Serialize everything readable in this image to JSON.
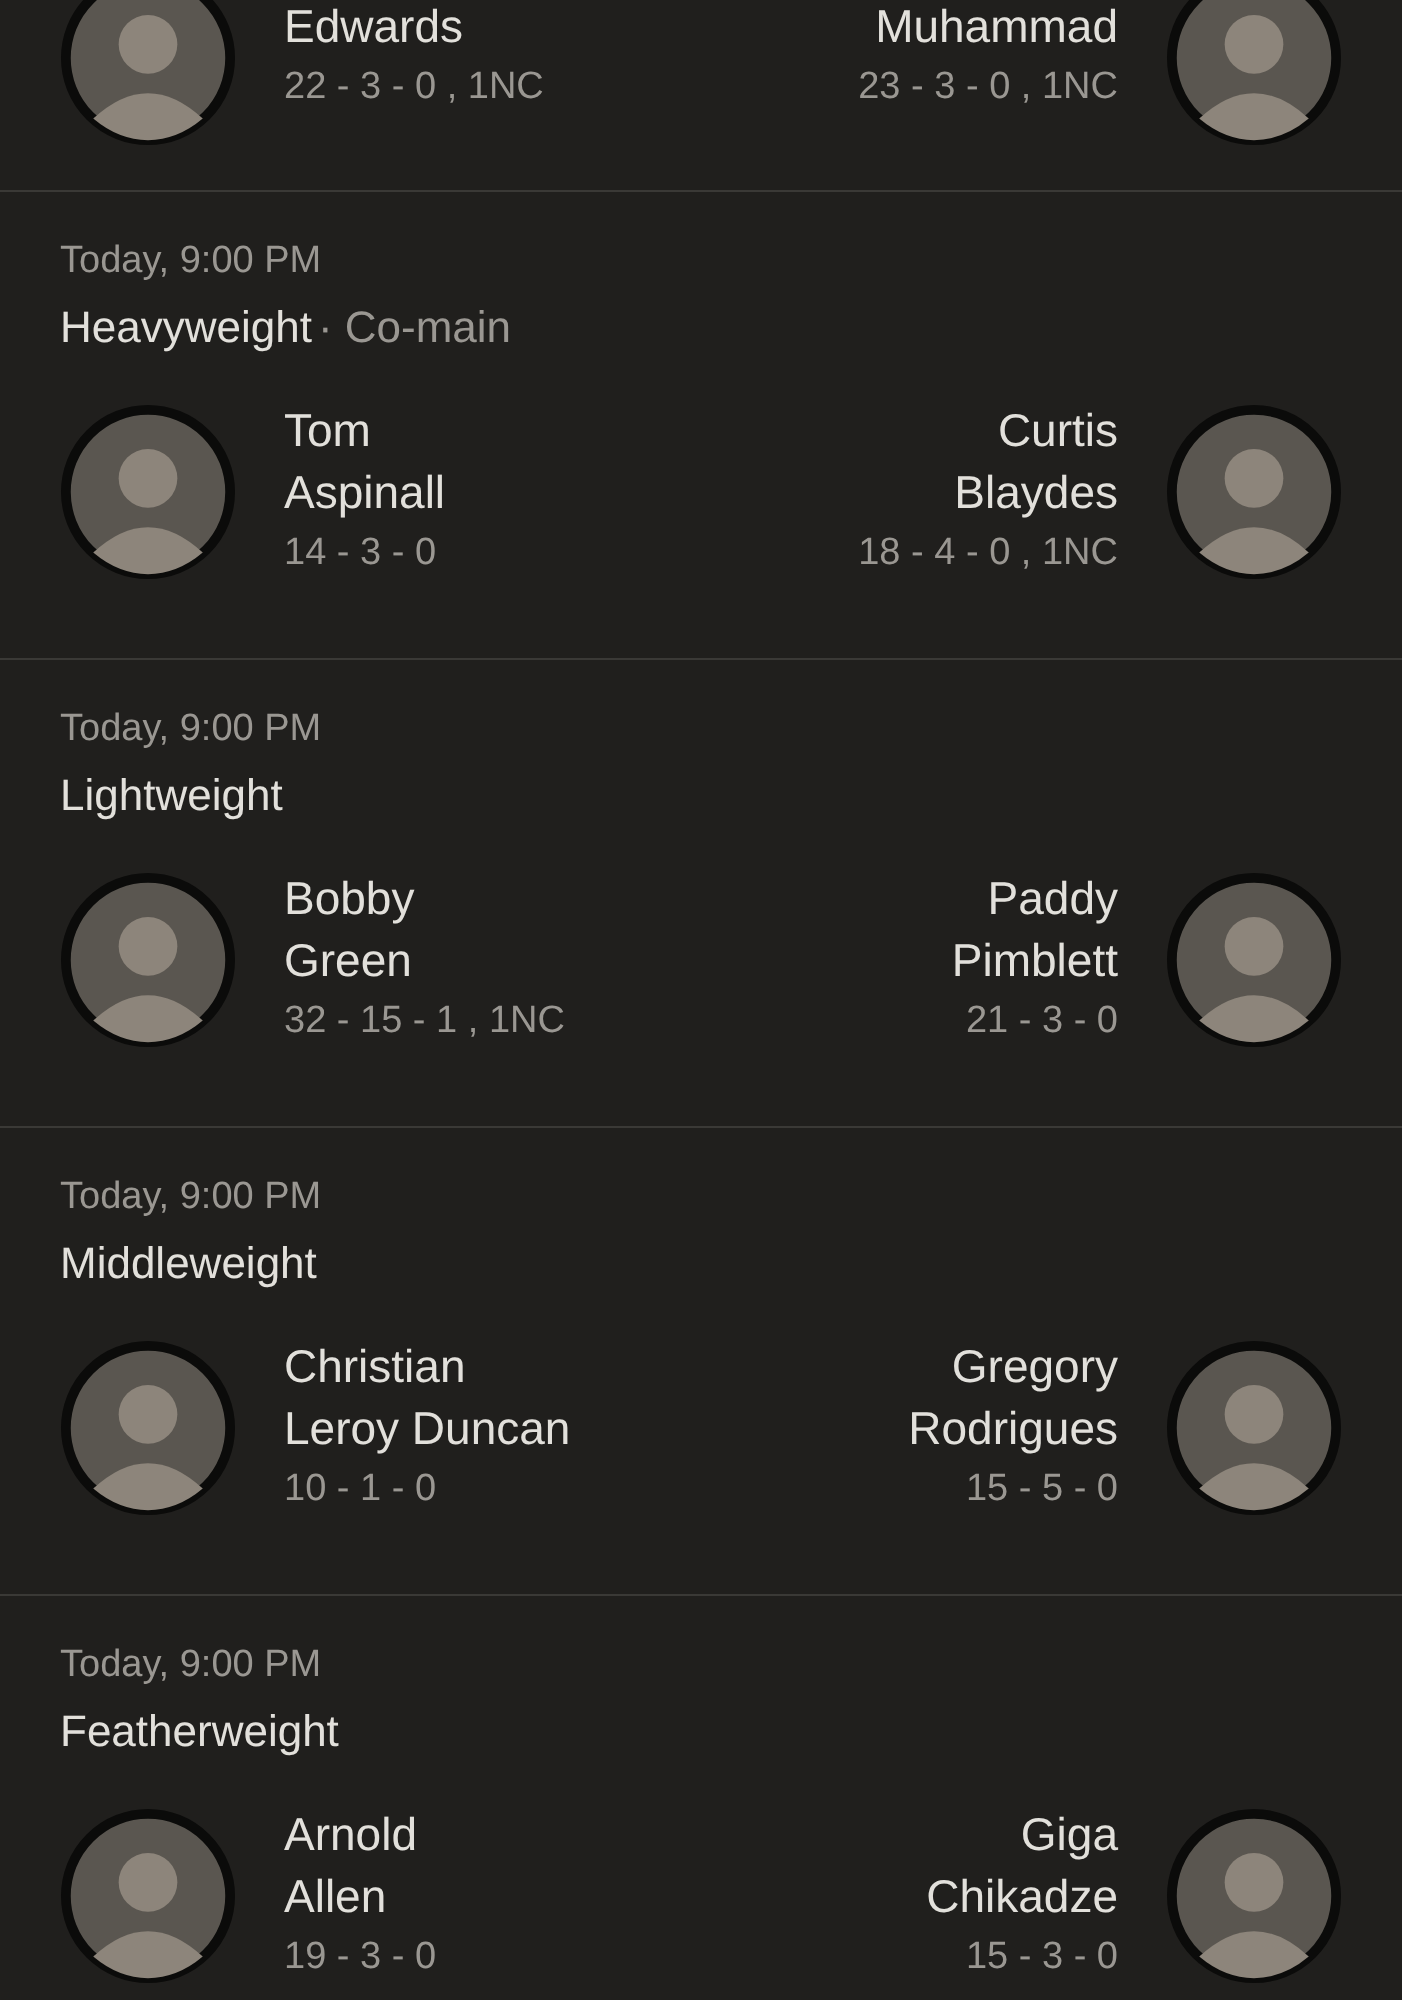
{
  "fights": [
    {
      "red": {
        "name_lines": [
          "Edwards"
        ],
        "record": "22 - 3 - 0 , 1NC"
      },
      "blue": {
        "name_lines": [
          "Muhammad"
        ],
        "record": "23 - 3 - 0 , 1NC"
      }
    },
    {
      "time": "Today, 9:00 PM",
      "weight_class": "Heavyweight",
      "note": "· Co-main",
      "red": {
        "name_lines": [
          "Tom",
          "Aspinall"
        ],
        "record": "14 - 3 - 0"
      },
      "blue": {
        "name_lines": [
          "Curtis",
          "Blaydes"
        ],
        "record": "18 - 4 - 0 , 1NC"
      }
    },
    {
      "time": "Today, 9:00 PM",
      "weight_class": "Lightweight",
      "red": {
        "name_lines": [
          "Bobby",
          "Green"
        ],
        "record": "32 - 15 - 1 , 1NC"
      },
      "blue": {
        "name_lines": [
          "Paddy",
          "Pimblett"
        ],
        "record": "21 - 3 - 0"
      }
    },
    {
      "time": "Today, 9:00 PM",
      "weight_class": "Middleweight",
      "red": {
        "name_lines": [
          "Christian",
          "Leroy Duncan"
        ],
        "record": "10 - 1 - 0"
      },
      "blue": {
        "name_lines": [
          "Gregory",
          "Rodrigues"
        ],
        "record": "15 - 5 - 0"
      }
    },
    {
      "time": "Today, 9:00 PM",
      "weight_class": "Featherweight",
      "red": {
        "name_lines": [
          "Arnold",
          "Allen"
        ],
        "record": "19 - 3 - 0"
      },
      "blue": {
        "name_lines": [
          "Giga",
          "Chikadze"
        ],
        "record": "15 - 3 - 0"
      }
    }
  ]
}
